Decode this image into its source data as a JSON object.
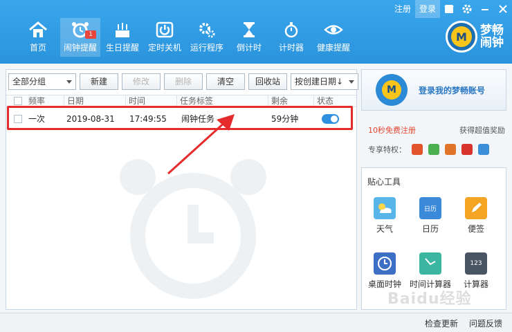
{
  "topbar": {
    "register": "注册",
    "login": "登录"
  },
  "nav": [
    {
      "label": "首页",
      "icon": "home-icon"
    },
    {
      "label": "闹钟提醒",
      "icon": "alarm-icon",
      "badge": "1"
    },
    {
      "label": "生日提醒",
      "icon": "cake-icon"
    },
    {
      "label": "定时关机",
      "icon": "power-icon"
    },
    {
      "label": "运行程序",
      "icon": "gears-icon"
    },
    {
      "label": "倒计时",
      "icon": "hourglass-icon"
    },
    {
      "label": "计时器",
      "icon": "stopwatch-icon"
    },
    {
      "label": "健康提醒",
      "icon": "eye-icon"
    }
  ],
  "logo": {
    "line1": "梦畅",
    "line2": "闹钟",
    "mark": "M"
  },
  "toolbar": {
    "group_select": "全部分组",
    "new": "新建",
    "edit": "修改",
    "delete": "删除",
    "clear": "清空",
    "recycle": "回收站",
    "sort_select": "按创建日期↓"
  },
  "table": {
    "headers": [
      "频率",
      "日期",
      "时间",
      "任务标签",
      "剩余",
      "状态"
    ],
    "rows": [
      {
        "freq": "一次",
        "date": "2019-08-31",
        "time": "17:49:55",
        "label": "闹钟任务",
        "remaining": "59分钟",
        "enabled": true
      }
    ]
  },
  "account": {
    "label": "登录我的梦畅账号",
    "mark": "M"
  },
  "promo": {
    "register": "10秒免费注册",
    "reward": "获得超值奖励"
  },
  "privileges": {
    "label": "专享特权：",
    "colors": [
      "#e2542b",
      "#4caf50",
      "#e0752a",
      "#d8342c",
      "#3a8fd8"
    ]
  },
  "tools": {
    "title": "贴心工具",
    "items": [
      {
        "label": "天气",
        "icon": "weather-icon",
        "color": "#57b5ea"
      },
      {
        "label": "日历",
        "icon": "calendar-icon",
        "color": "#3b8ad9",
        "text": "日历"
      },
      {
        "label": "便签",
        "icon": "note-icon",
        "color": "#f4a423"
      },
      {
        "label": "桌面时钟",
        "icon": "desk-clock-icon",
        "color": "#3d6fc5"
      },
      {
        "label": "时间计算器",
        "icon": "time-calc-icon",
        "color": "#3bb6a0"
      },
      {
        "label": "计算器",
        "icon": "calculator-icon",
        "color": "#4a5563",
        "text": "123"
      }
    ]
  },
  "footer": {
    "update": "检查更新",
    "feedback": "问题反馈"
  },
  "watermark": "Baidu经验"
}
